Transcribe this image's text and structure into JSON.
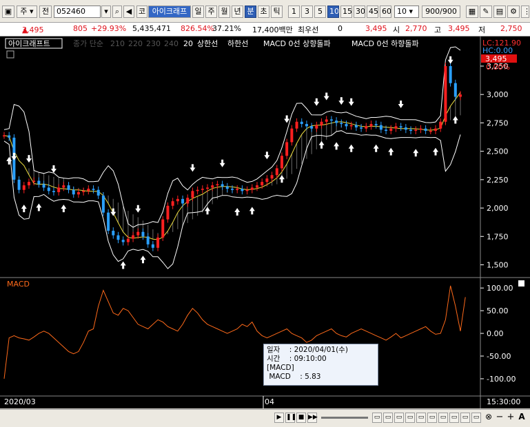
{
  "toolbar": {
    "market": "주",
    "prev_label": "전",
    "code": "052460",
    "market2": "코",
    "stock_name": "아이크래프",
    "periods": [
      "일",
      "주",
      "월",
      "년",
      "분",
      "초",
      "틱"
    ],
    "selected_period": "분",
    "intervals": [
      "1",
      "3",
      "5",
      "10",
      "15",
      "30",
      "45",
      "60"
    ],
    "selected_interval": "10",
    "interval_value": "10",
    "count": "900",
    "count_total": "/900"
  },
  "quote": {
    "price": "3,495",
    "change": "805",
    "change_pct": "+29.93%",
    "volume": "5,435,471",
    "volume_ratio": "826.54%",
    "turnover": "37.21%",
    "amount": "17,400백만",
    "option_label": "최우선",
    "option_value": "0",
    "current": "3,495",
    "open_label": "시",
    "open": "2,770",
    "high_label": "고",
    "high": "3,495",
    "low_label": "저",
    "low": "2,750"
  },
  "legend": {
    "name": "아이크래프트",
    "ma_label": "종가 단순",
    "ma_periods": [
      "210",
      "220",
      "230",
      "240",
      "20"
    ],
    "items": [
      "상한선",
      "하한선",
      "MACD 0선 상향돌파",
      "MACD 0선 하향돌파"
    ]
  },
  "price_axis": {
    "lc": "LC:121.90",
    "hc": "HC:0.00",
    "last": "3,495",
    "pct": "0.00%",
    "ticks": [
      "3,250",
      "3,000",
      "2,750",
      "2,500",
      "2,250",
      "2,000",
      "1,750",
      "1,500"
    ]
  },
  "macd": {
    "label": "MACD",
    "ticks": [
      "100.00",
      "50.00",
      "0.00",
      "-50.00",
      "-100.00"
    ]
  },
  "time_axis": {
    "start": "2020/03",
    "mid": "04",
    "end": "15:30:00"
  },
  "tooltip": {
    "date_label": "일자",
    "date_value": ": 2020/04/01(수)",
    "time_label": "시간",
    "time_value": ": 09:10:00",
    "section": "[MACD]",
    "macd_label": "MACD",
    "macd_value": ": 5.83"
  },
  "colors": {
    "up": "#ff2020",
    "down": "#2aa0ff",
    "macd": "#ff6a1a",
    "band": "#ffffff"
  },
  "chart_data": {
    "type": "line",
    "price_series": [
      2640,
      2620,
      2250,
      2160,
      2200,
      2230,
      2240,
      2210,
      2180,
      2150,
      2140,
      2180,
      2200,
      2160,
      2120,
      2140,
      2150,
      2170,
      2160,
      2110,
      1960,
      1800,
      1760,
      1720,
      1700,
      1730,
      1760,
      1790,
      1750,
      1680,
      1650,
      1740,
      1900,
      2020,
      2060,
      2080,
      2040,
      2090,
      2150,
      2160,
      2170,
      2180,
      2200,
      2210,
      2190,
      2170,
      2160,
      2170,
      2150,
      2160,
      2180,
      2200,
      2230,
      2260,
      2290,
      2350,
      2460,
      2580,
      2700,
      2760,
      2740,
      2720,
      2700,
      2730,
      2760,
      2780,
      2770,
      2750,
      2740,
      2720,
      2730,
      2710,
      2700,
      2720,
      2740,
      2730,
      2690,
      2680,
      2700,
      2720,
      2710,
      2690,
      2680,
      2690,
      2700,
      2680,
      2680,
      2700,
      2760,
      3250,
      3100,
      2980,
      3000
    ],
    "macd_series": [
      -100,
      -10,
      -5,
      -10,
      -12,
      -15,
      -8,
      0,
      5,
      0,
      -10,
      -20,
      -30,
      -40,
      -45,
      -40,
      -20,
      5,
      10,
      60,
      95,
      70,
      45,
      40,
      55,
      50,
      35,
      20,
      15,
      10,
      20,
      30,
      25,
      15,
      10,
      5,
      20,
      40,
      55,
      45,
      30,
      20,
      15,
      10,
      5,
      0,
      5,
      10,
      20,
      15,
      25,
      5,
      -5,
      -10,
      -5,
      0,
      5,
      10,
      0,
      -5,
      -10,
      -20,
      -15,
      -5,
      0,
      5,
      10,
      0,
      -5,
      -8,
      0,
      5,
      10,
      5,
      0,
      -5,
      -10,
      -15,
      -8,
      0,
      -10,
      -5,
      0,
      5,
      10,
      15,
      5,
      -2,
      0,
      30,
      105,
      60,
      5,
      80
    ],
    "price_ylim": [
      1400,
      3450
    ],
    "macd_ylim": [
      -135,
      120
    ],
    "up_arrow_idx": [
      1,
      4,
      7,
      12,
      24,
      28,
      41,
      47,
      50,
      56,
      64,
      67,
      70,
      75,
      78,
      83,
      87,
      91
    ],
    "down_arrow_idx": [
      2,
      5,
      10,
      22,
      27,
      38,
      44,
      53,
      57,
      63,
      65,
      68,
      70,
      80,
      90
    ]
  }
}
